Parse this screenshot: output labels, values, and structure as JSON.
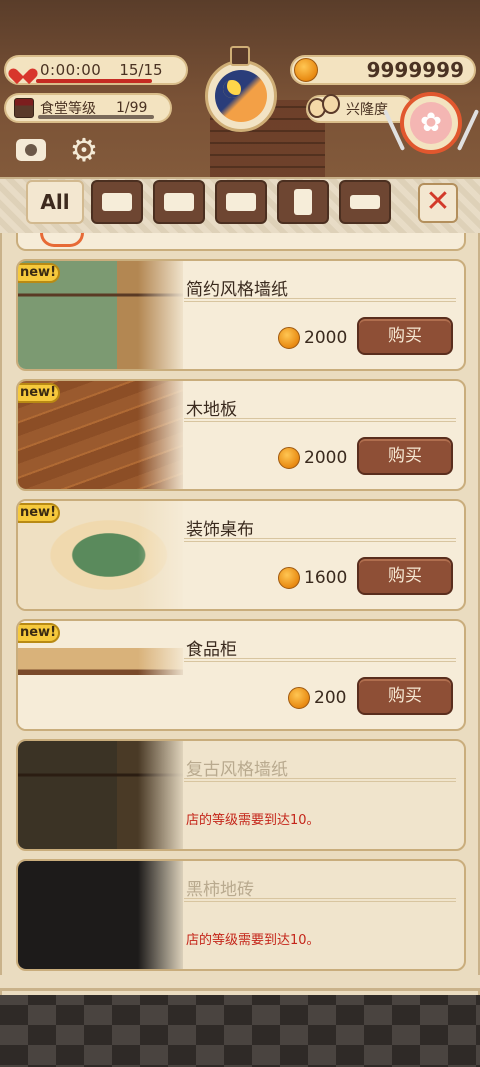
{
  "hud": {
    "timer": "0:00:00",
    "lives": "15/15",
    "level_label": "食堂等级",
    "level_value": "1/99",
    "coins": "9999999",
    "popularity_label": "兴隆度",
    "plate_symbol": "✿"
  },
  "tabs": {
    "all_label": "All",
    "close_symbol": "✕",
    "gear_symbol": "⚙"
  },
  "items": [
    {
      "name": "简约风格墙纸",
      "price": "2000",
      "buy_label": "购买",
      "badge": "new!"
    },
    {
      "name": "木地板",
      "price": "2000",
      "buy_label": "购买",
      "badge": "new!"
    },
    {
      "name": "装饰桌布",
      "price": "1600",
      "buy_label": "购买",
      "badge": "new!"
    },
    {
      "name": "食品柜",
      "price": "200",
      "buy_label": "购买",
      "badge": "new!"
    },
    {
      "name": "复古风格墙纸",
      "lock_message": "店的等级需要到达10。"
    },
    {
      "name": "黑柿地砖",
      "lock_message": "店的等级需要到达10。"
    }
  ],
  "colors": {
    "accent_red": "#c4261a",
    "coin_gold": "#e88a12",
    "buy_button": "#8e4f36",
    "badge_yellow": "#f6c93c"
  },
  "icons": [
    "heart-icon",
    "shop-icon",
    "coin-icon",
    "moon-clock-icon",
    "faces-icon",
    "plate-icon",
    "camera-icon",
    "gear-icon",
    "table-icon",
    "close-icon"
  ]
}
